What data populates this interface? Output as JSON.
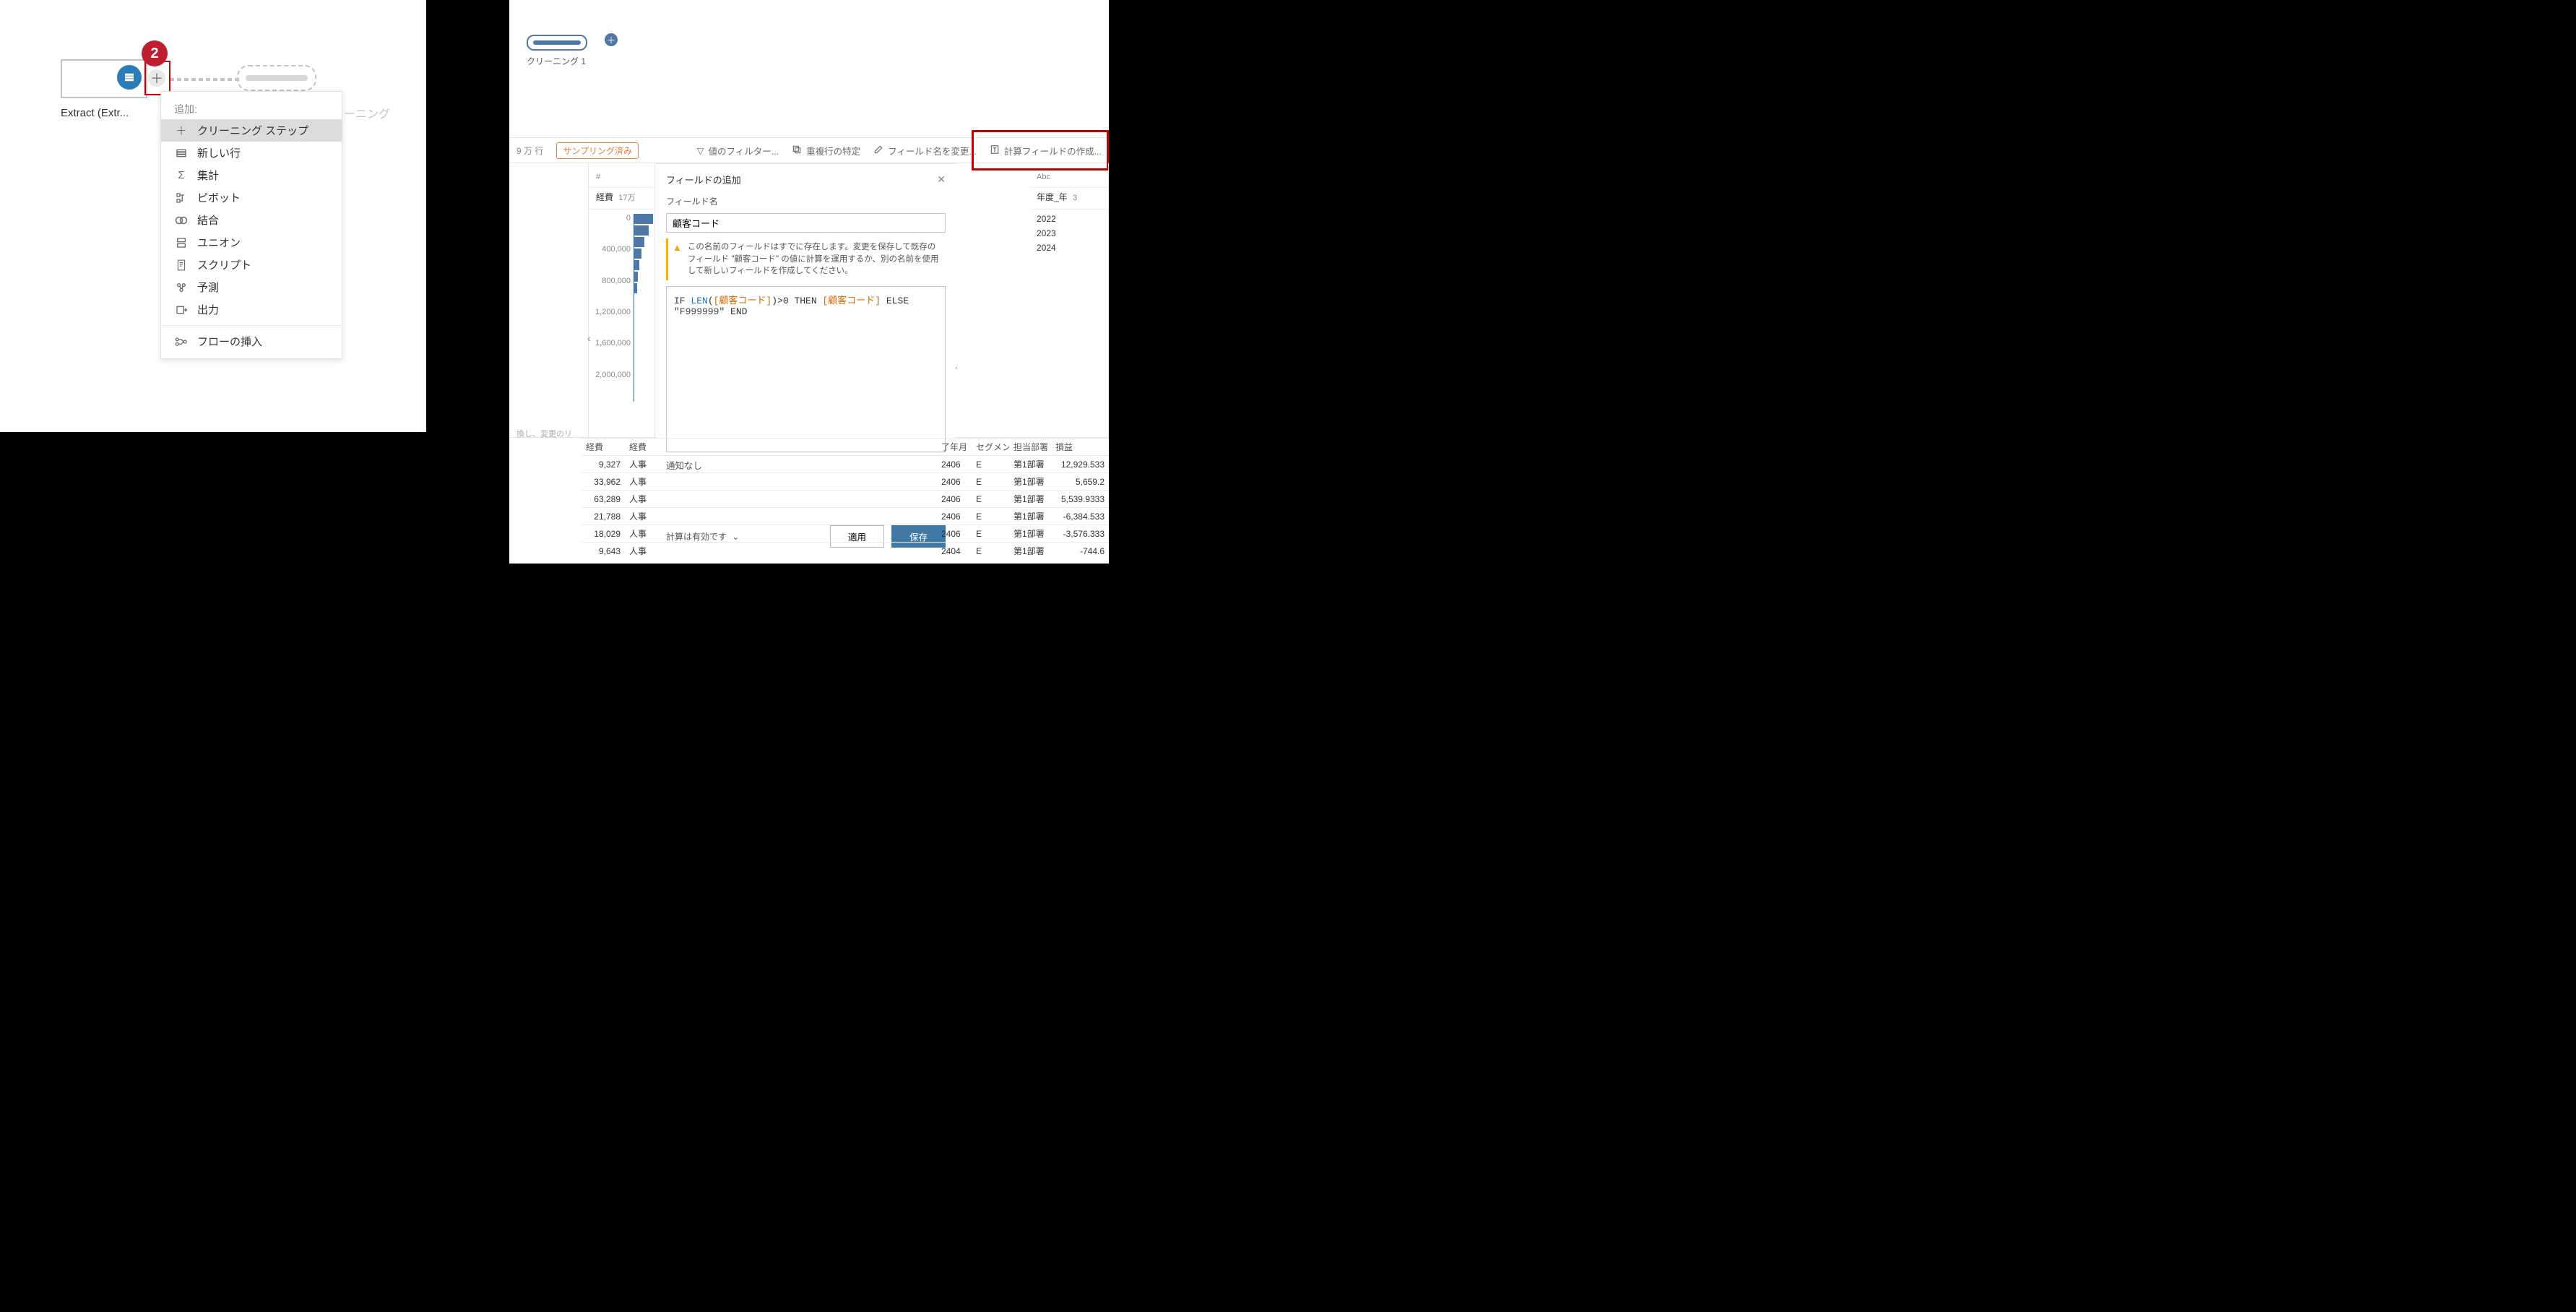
{
  "left": {
    "source_label": "Extract (Extr...",
    "ghost_label": "ーニング",
    "badge": "2",
    "menu_title": "追加:",
    "menu": [
      {
        "icon": "＋",
        "label": "クリーニング ステップ",
        "selected": true
      },
      {
        "icon": "rows",
        "label": "新しい行"
      },
      {
        "icon": "Σ",
        "label": "集計"
      },
      {
        "icon": "pivot",
        "label": "ピボット"
      },
      {
        "icon": "join",
        "label": "結合"
      },
      {
        "icon": "union",
        "label": "ユニオン"
      },
      {
        "icon": "script",
        "label": "スクリプト"
      },
      {
        "icon": "predict",
        "label": "予測"
      },
      {
        "icon": "output",
        "label": "出力"
      }
    ],
    "menu_insert_label": "フローの挿入"
  },
  "right": {
    "clean_label": "クリーニング 1",
    "toolbar": {
      "rowcount_suffix": "9 万 行",
      "sampled": "サンプリング済み",
      "filter": "値のフィルター...",
      "dup": "重複行の特定",
      "rename": "フィールド名を変更...",
      "calc": "計算フィールドの作成..."
    },
    "profile_left": {
      "type": "#",
      "title": "経費",
      "count": "17万"
    },
    "axis": [
      "0",
      "400,000",
      "800,000",
      "1,200,000",
      "1,600,000",
      "2,000,000"
    ],
    "profile_right": {
      "type": "Abc",
      "title": "年度_年",
      "count": "3",
      "years": [
        "2022",
        "2023",
        "2024"
      ]
    },
    "scroll_hint": "換し、変更のリ",
    "dialog": {
      "title": "フィールドの追加",
      "name_label": "フィールド名",
      "name_value": "顧客コード",
      "warning": "この名前のフィールドはすでに存在します。変更を保存して既存のフィールド \"顧客コード\" の値に計算を運用するか、別の名前を使用して新しいフィールドを作成してください。",
      "formula_html": "IF <span class='fn'>LEN</span>(<span class='fld'>[顧客コード]</span>)>0 THEN <span class='fld'>[顧客コード]</span> ELSE <span class='str'>\"F999999\"</span> END",
      "notice": "通知なし",
      "status": "計算は有効です",
      "apply": "適用",
      "save": "保存"
    },
    "grid": {
      "headers": [
        "経費",
        "経費",
        "了年月",
        "セグメン",
        "担当部署",
        "損益"
      ],
      "rows": [
        [
          "9,327",
          "人事",
          "2406",
          "E",
          "第1部署",
          "12,929.533"
        ],
        [
          "33,962",
          "人事",
          "2406",
          "E",
          "第1部署",
          "5,659.2"
        ],
        [
          "63,289",
          "人事",
          "2406",
          "E",
          "第1部署",
          "5,539.9333"
        ],
        [
          "21,788",
          "人事",
          "2406",
          "E",
          "第1部署",
          "-6,384.533"
        ],
        [
          "18,029",
          "人事",
          "2406",
          "E",
          "第1部署",
          "-3,576.333"
        ],
        [
          "9,643",
          "人事",
          "2404",
          "E",
          "第1部署",
          "-744.6"
        ]
      ]
    }
  }
}
